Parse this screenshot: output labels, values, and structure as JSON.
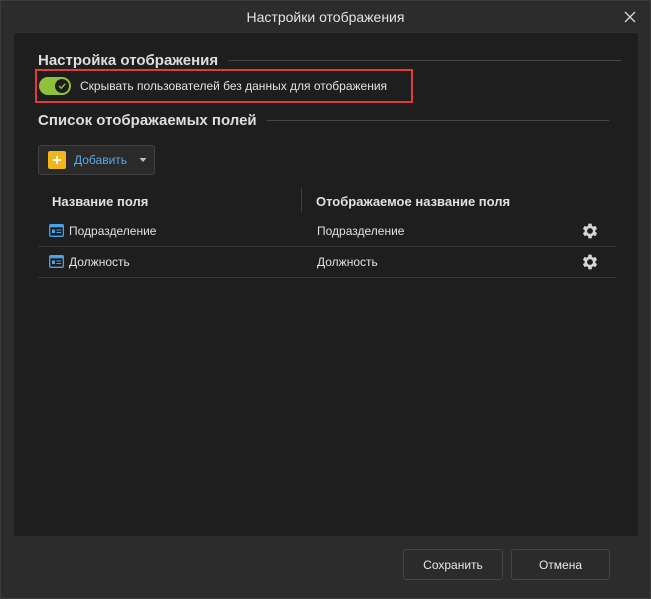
{
  "window": {
    "title": "Настройки отображения"
  },
  "display_settings": {
    "header": "Настройка отображения",
    "toggle": {
      "label": "Скрывать пользователей без данных для отображения",
      "checked": true
    }
  },
  "fields": {
    "header": "Список отображаемых полей",
    "add_button_label": "Добавить",
    "columns": [
      "Название поля",
      "Отображаемое название поля"
    ],
    "rows": [
      {
        "name": "Подразделение",
        "display_name": "Подразделение"
      },
      {
        "name": "Должность",
        "display_name": "Должность"
      }
    ]
  },
  "footer": {
    "save_label": "Сохранить",
    "cancel_label": "Отмена"
  },
  "colors": {
    "accent_toggle": "#8fc23a",
    "add_icon": "#f3b51d",
    "link": "#5aa8e8",
    "highlight": "#e03c3c"
  }
}
